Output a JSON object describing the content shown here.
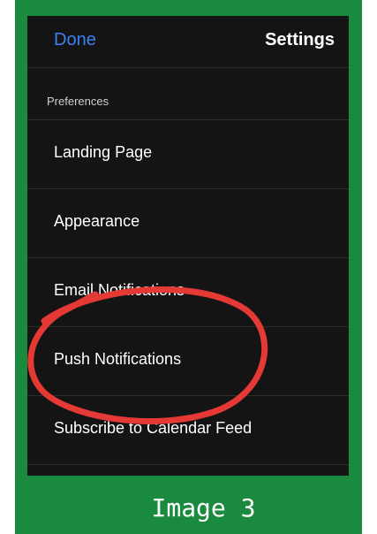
{
  "nav": {
    "done_label": "Done",
    "title": "Settings"
  },
  "section": {
    "header": "Preferences"
  },
  "rows": [
    {
      "label": "Landing Page"
    },
    {
      "label": "Appearance"
    },
    {
      "label": "Email Notifications"
    },
    {
      "label": "Push Notifications"
    },
    {
      "label": "Subscribe to Calendar Feed"
    }
  ],
  "caption": "Image 3",
  "colors": {
    "frame": "#1a8a3f",
    "screen_background": "#141414",
    "accent": "#3b82f6",
    "annotation_circle": "#e53935"
  }
}
